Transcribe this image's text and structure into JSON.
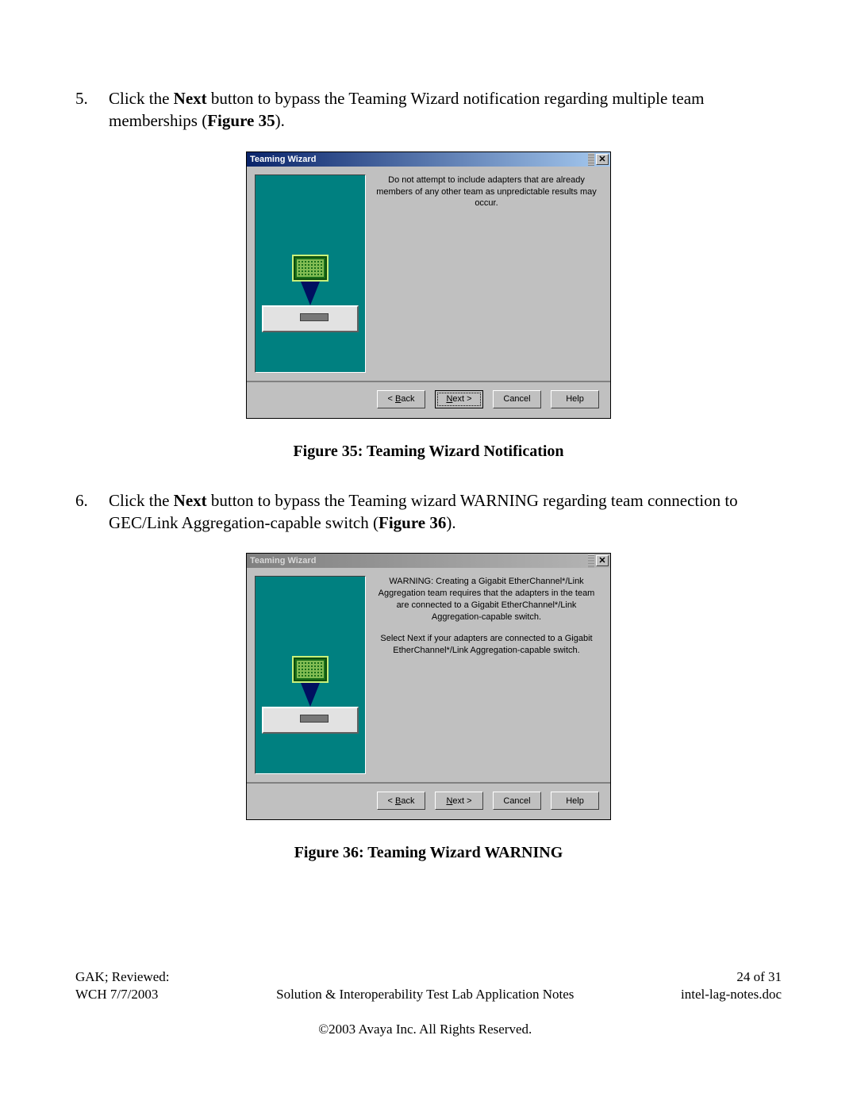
{
  "step5": {
    "number": "5.",
    "pre": "Click the ",
    "bold1": "Next",
    "mid": " button to bypass the Teaming Wizard notification regarding multiple team memberships (",
    "bold2": "Figure 35",
    "post": ")."
  },
  "dialog1": {
    "title": "Teaming Wizard",
    "message": "Do not attempt to include adapters that are already members of any other team as unpredictable results may occur.",
    "buttons": {
      "back": "< Back",
      "next": "Next >",
      "cancel": "Cancel",
      "help": "Help"
    }
  },
  "caption1": "Figure 35: Teaming Wizard Notification",
  "step6": {
    "number": "6.",
    "pre": "Click the ",
    "bold1": "Next",
    "mid": " button to bypass the Teaming wizard WARNING regarding team connection to GEC/Link Aggregation-capable switch (",
    "bold2": "Figure 36",
    "post": ")."
  },
  "dialog2": {
    "title": "Teaming Wizard",
    "warn": "WARNING: Creating a Gigabit EtherChannel*/Link Aggregation team requires that the adapters in the team are connected to a Gigabit EtherChannel*/Link Aggregation-capable switch.",
    "note": "Select Next if your adapters are connected to a Gigabit EtherChannel*/Link Aggregation-capable switch.",
    "buttons": {
      "back": "< Back",
      "next": "Next >",
      "cancel": "Cancel",
      "help": "Help"
    }
  },
  "caption2": "Figure 36: Teaming Wizard WARNING",
  "footer": {
    "left": "GAK; Reviewed:\nWCH 7/7/2003",
    "centerL1": "Solution & Interoperability Test Lab Application Notes",
    "centerL2": "©2003 Avaya Inc. All Rights Reserved.",
    "right": "24 of 31\nintel-lag-notes.doc"
  }
}
